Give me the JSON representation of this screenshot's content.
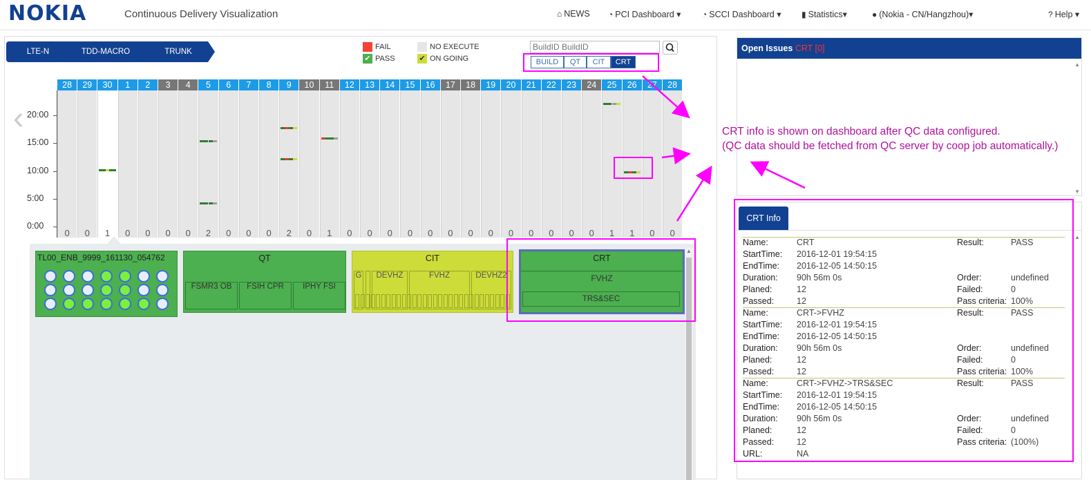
{
  "header": {
    "logo": "NOKIA",
    "title": "Continuous Delivery Visualization",
    "nav": [
      {
        "icon": "home-icon",
        "glyph": "⌂",
        "label": "NEWS"
      },
      {
        "icon": "dashboard-icon",
        "glyph": "◔",
        "label": "PCI Dashboard ▾"
      },
      {
        "icon": "dashboard-icon",
        "glyph": "◔",
        "label": "SCCI Dashboard ▾"
      },
      {
        "icon": "bar-chart-icon",
        "glyph": "▮",
        "label": "Statistics▾"
      },
      {
        "icon": "user-icon",
        "glyph": "●",
        "label": "(Nokia - CN/Hangzhou)▾"
      },
      {
        "icon": "help-icon",
        "glyph": "?",
        "label": "Help ▾"
      }
    ]
  },
  "breadcrumb": [
    "LTE-N",
    "TDD-MACRO",
    "TRUNK"
  ],
  "legend": {
    "fail": "FAIL",
    "pass": "PASS",
    "no_execute": "NO EXECUTE",
    "ongoing": "ON GOING",
    "colors": {
      "fail": "#f44336",
      "pass": "#4caf50",
      "no_execute": "#e6e6e6",
      "ongoing": "#cddc39"
    }
  },
  "search": {
    "placeholder": "BuildID BuildID"
  },
  "view_tabs": [
    "BUILD",
    "QT",
    "CIT",
    "CRT"
  ],
  "active_tab": "CRT",
  "chart_data": {
    "type": "scatter",
    "x": [
      "28",
      "29",
      "30",
      "1",
      "2",
      "3",
      "4",
      "5",
      "6",
      "7",
      "8",
      "9",
      "10",
      "11",
      "12",
      "13",
      "14",
      "15",
      "16",
      "17",
      "18",
      "19",
      "20",
      "21",
      "22",
      "23",
      "24",
      "25",
      "26",
      "27",
      "28"
    ],
    "day_weekend": [
      false,
      false,
      false,
      false,
      false,
      true,
      true,
      false,
      false,
      false,
      false,
      false,
      true,
      true,
      false,
      false,
      false,
      false,
      false,
      true,
      true,
      false,
      false,
      false,
      false,
      false,
      true,
      false,
      false,
      false,
      false
    ],
    "counts": [
      0,
      0,
      1,
      0,
      0,
      0,
      0,
      2,
      0,
      0,
      0,
      2,
      0,
      1,
      0,
      0,
      0,
      0,
      0,
      0,
      0,
      0,
      0,
      0,
      0,
      0,
      0,
      1,
      1,
      0,
      0
    ],
    "yticks": [
      "20:00",
      "15:00",
      "10:00",
      "5:00",
      "0:00"
    ],
    "ylim": [
      0,
      24
    ],
    "builds": [
      {
        "day_index": 2,
        "hour": 10.3,
        "segments": [
          "pass",
          "pass",
          "ongoing",
          "pass",
          "pass"
        ]
      },
      {
        "day_index": 7,
        "hour": 15.5,
        "segments": [
          "pass",
          "pass",
          "pass",
          "no"
        ]
      },
      {
        "day_index": 7,
        "hour": 4.3,
        "segments": [
          "pass",
          "pass",
          "pass",
          "no"
        ]
      },
      {
        "day_index": 11,
        "hour": 17.9,
        "segments": [
          "pass",
          "fail",
          "pass",
          "ongoing"
        ]
      },
      {
        "day_index": 11,
        "hour": 12.3,
        "segments": [
          "pass",
          "fail",
          "pass",
          "ongoing"
        ]
      },
      {
        "day_index": 13,
        "hour": 16.1,
        "segments": [
          "fail",
          "pass",
          "pass",
          "no"
        ]
      },
      {
        "day_index": 27,
        "hour": 22.2,
        "segments": [
          "pass",
          "pass",
          "no",
          "ongoing"
        ]
      },
      {
        "day_index": 28,
        "hour": 10.0,
        "segments": [
          "pass",
          "fail",
          "pass",
          "ongoing"
        ]
      }
    ]
  },
  "detail": {
    "build_name": "TL00_ENB_9999_161130_054762",
    "build_circles": [
      [
        "empty",
        "empty",
        "empty",
        "green",
        "green",
        "empty",
        "empty"
      ],
      [
        "empty",
        "empty",
        "empty",
        "green",
        "green",
        "empty",
        "empty"
      ],
      [
        "empty",
        "green",
        "green",
        "green",
        "green",
        "green",
        "empty"
      ]
    ],
    "qt": {
      "title": "QT",
      "items": [
        "FSMR3 OB",
        "FSIH CPR",
        "IPHY FSI"
      ]
    },
    "cit": {
      "title": "CIT",
      "items": [
        "G",
        "DEVHZ",
        "FVHZ",
        "DEVHZ2"
      ]
    },
    "crt": {
      "title": "CRT",
      "items": [
        "FVHZ",
        "TRS&SEC"
      ]
    }
  },
  "issues": {
    "title": "Open Issues",
    "badge": "CRT [0]"
  },
  "crt_info": {
    "tab": "CRT Info",
    "labels": {
      "name": "Name:",
      "start": "StartTime:",
      "end": "EndTime:",
      "duration": "Duration:",
      "planed": "Planed:",
      "passed": "Passed:",
      "result": "Result:",
      "order": "Order:",
      "failed": "Failed:",
      "criteria": "Pass criteria:",
      "url": "URL:"
    },
    "records": [
      {
        "name": "CRT",
        "start": "2016-12-01 19:54:15",
        "end": "2016-12-05 14:50:15",
        "duration": "90h 56m 0s",
        "planed": "12",
        "passed": "12",
        "result": "PASS",
        "order": "undefined",
        "failed": "0",
        "criteria": "100%"
      },
      {
        "name": "CRT->FVHZ",
        "start": "2016-12-01 19:54:15",
        "end": "2016-12-05 14:50:15",
        "duration": "90h 56m 0s",
        "planed": "12",
        "passed": "12",
        "result": "PASS",
        "order": "undefined",
        "failed": "0",
        "criteria": "100%"
      },
      {
        "name": "CRT->FVHZ->TRS&SEC",
        "start": "2016-12-01 19:54:15",
        "end": "2016-12-05 14:50:15",
        "duration": "90h 56m 0s",
        "planed": "12",
        "passed": "12",
        "result": "PASS",
        "order": "undefined",
        "failed": "0",
        "criteria": "(100%)",
        "url": "NA"
      }
    ]
  },
  "annotation": [
    "CRT info is shown on dashboard after QC data configured.",
    "(QC data should be fetched from QC server by coop job automatically.)"
  ]
}
